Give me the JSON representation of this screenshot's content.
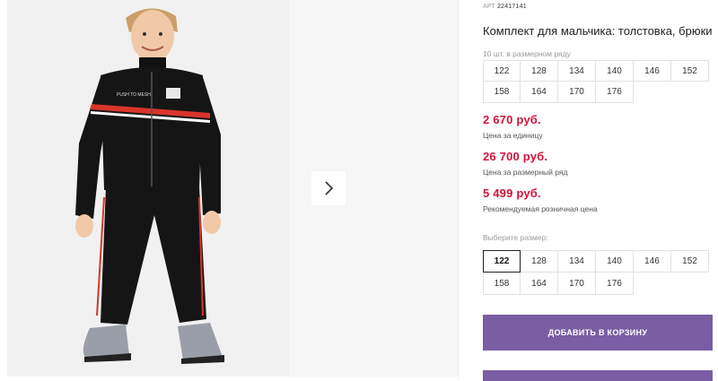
{
  "gallery": {
    "photo_alt": "Мальчик в чёрном спортивном костюме",
    "next_icon": "chevron-right-icon",
    "chest_print": "PUSH TO MESH"
  },
  "product": {
    "art_label": "АРТ",
    "art_number": "22417141",
    "title": "Комплект для мальчика: толстовка, брюки",
    "sizes_caption": "10 шт. в размерном ряду",
    "size_grid": [
      "122",
      "128",
      "134",
      "140",
      "146",
      "152",
      "158",
      "164",
      "170",
      "176"
    ],
    "prices": [
      {
        "value": "2 670 руб.",
        "label": "Цена за единицу"
      },
      {
        "value": "26 700 руб.",
        "label": "Цена за размерный ряд"
      },
      {
        "value": "5 499 руб.",
        "label": "Рекомендуемая розничная цена"
      }
    ],
    "choose_label": "Выберите размер:",
    "choose_sizes": [
      "122",
      "128",
      "134",
      "140",
      "146",
      "152",
      "158",
      "164",
      "170",
      "176"
    ],
    "selected_size": "122",
    "add_to_cart": "ДОБАВИТЬ В КОРЗИНУ"
  },
  "colors": {
    "price_red": "#d4123b",
    "button_purple": "#7a5ea3"
  }
}
